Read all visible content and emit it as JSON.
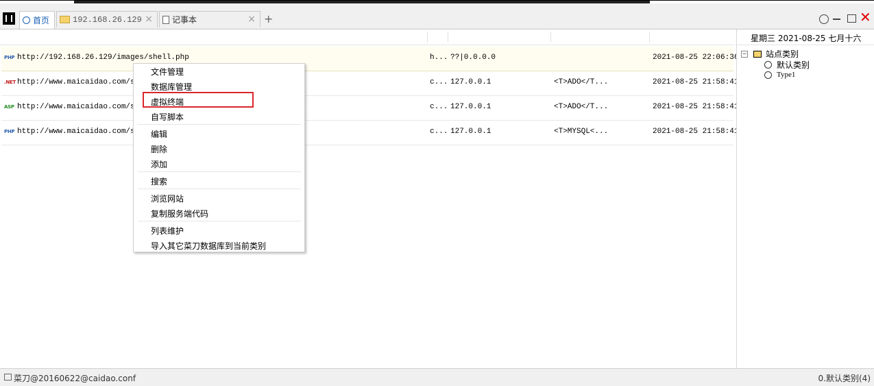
{
  "tabs": [
    {
      "label": "首页",
      "icon": "home-icon",
      "active": true
    },
    {
      "label": "192.168.26.129",
      "icon": "folder-icon",
      "close": "×"
    },
    {
      "label": "记事本",
      "icon": "doc-icon",
      "close": "×"
    }
  ],
  "add_tab": "+",
  "window_close": "✕",
  "rows": [
    {
      "badge": "PHP",
      "badge_color": "#2a5db0",
      "url": "http://192.168.26.129/images/shell.php",
      "col1": "h...",
      "col2": "??|0.0.0.0",
      "col3": "",
      "time": "2021-08-25 22:06:36"
    },
    {
      "badge": ".NET",
      "badge_color": "#c02020",
      "url": "http://www.maicaidao.com/ser",
      "col1": "c...",
      "col2": "127.0.0.1",
      "col3": "<T>ADO</T...",
      "time": "2021-08-25 21:58:41"
    },
    {
      "badge": "ASP",
      "badge_color": "#208a20",
      "url": "http://www.maicaidao.com/ser",
      "col1": "c...",
      "col2": "127.0.0.1",
      "col3": "<T>ADO</T...",
      "time": "2021-08-25 21:58:41"
    },
    {
      "badge": "PHP",
      "badge_color": "#2a5db0",
      "url": "http://www.maicaidao.com/ser",
      "col1": "c...",
      "col2": "127.0.0.1",
      "col3": "<T>MYSQL<...",
      "time": "2021-08-25 21:58:41"
    }
  ],
  "right_panel": {
    "date": "星期三  2021-08-25  七月十六",
    "tree_toggle": "−",
    "root_label": "站点类别",
    "children": [
      "默认类别",
      "Type1"
    ]
  },
  "context_menu": {
    "items": [
      "文件管理",
      "数据库管理",
      "虚拟终端",
      "自写脚本",
      "编辑",
      "删除",
      "添加",
      "搜索",
      "浏览网站",
      "复制服务端代码",
      "列表维护",
      "导入其它菜刀数据库到当前类别"
    ],
    "highlighted": "虚拟终端"
  },
  "status": {
    "left": "菜刀@20160622@caidao.conf",
    "right": "0.默认类别(4)"
  }
}
